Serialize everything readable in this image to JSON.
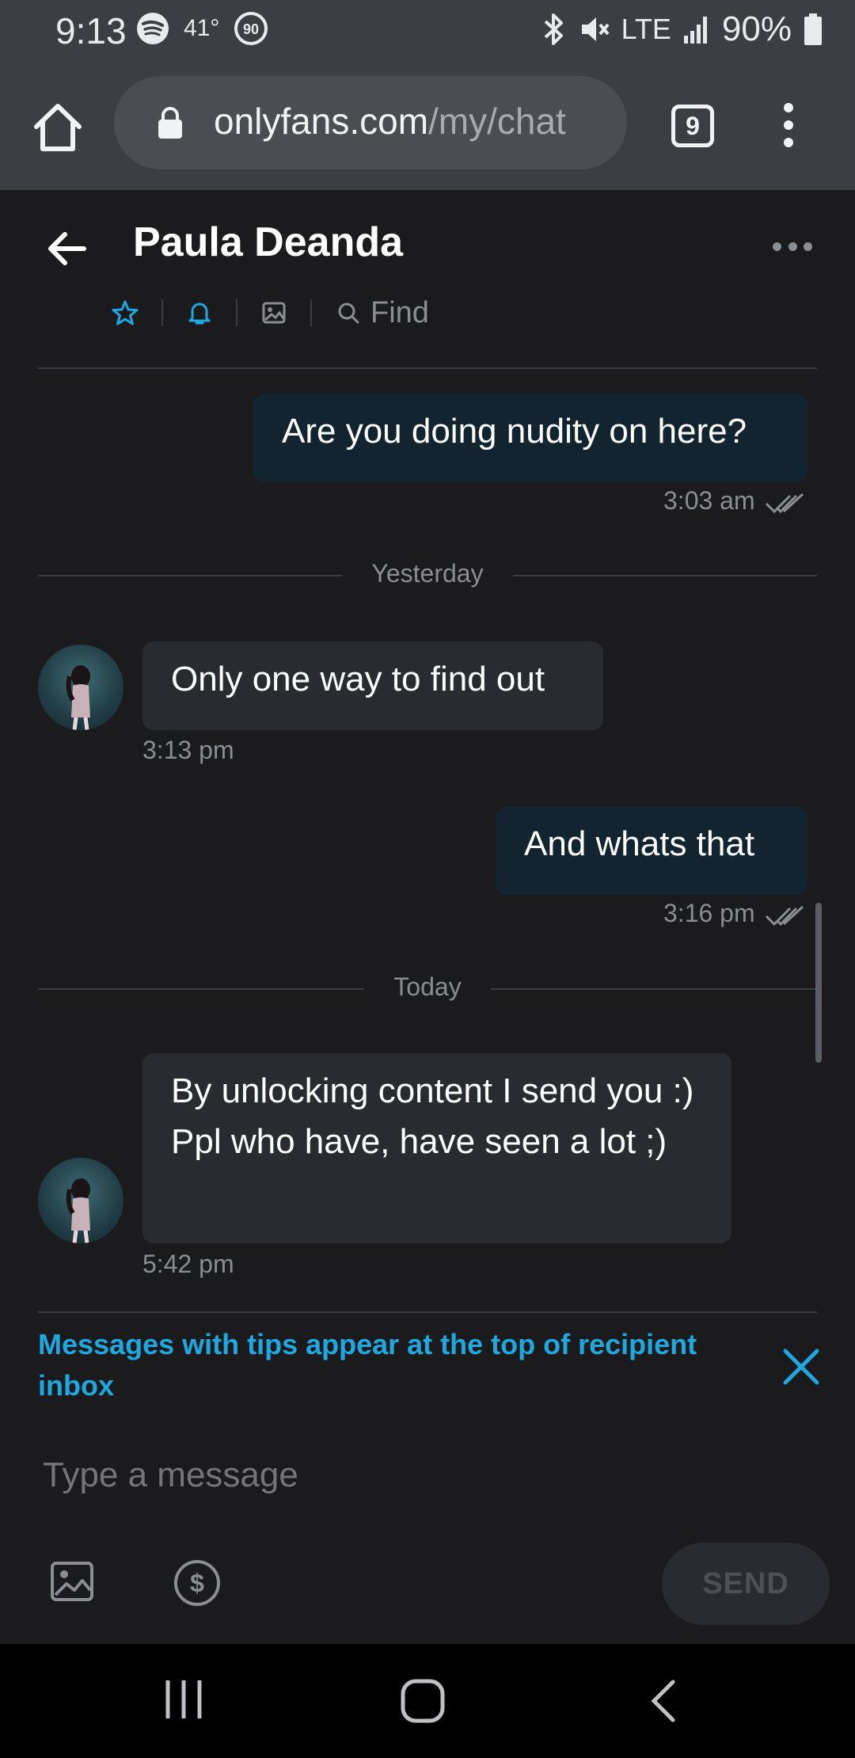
{
  "status_bar": {
    "time": "9:13",
    "temperature": "41°",
    "battery": "90%",
    "network": "LTE",
    "icons": [
      "spotify-icon",
      "temperature-90-icon",
      "bluetooth-icon",
      "mute-icon",
      "signal-icon",
      "battery-icon"
    ]
  },
  "browser": {
    "url_host": "onlyfans.com",
    "url_path": "/my/chat",
    "tab_count": "9"
  },
  "chat": {
    "title": "Paula Deanda",
    "find_label": "Find"
  },
  "messages": [
    {
      "direction": "out",
      "text": "Are you doing nudity on here?",
      "time": "3:03 am"
    },
    {
      "type": "day",
      "label": "Yesterday"
    },
    {
      "direction": "in",
      "text": "Only one way to find out",
      "time": "3:13 pm"
    },
    {
      "direction": "out",
      "text": "And whats that",
      "time": "3:16 pm"
    },
    {
      "type": "day",
      "label": "Today"
    },
    {
      "direction": "in",
      "text": "By unlocking content I send you :) Ppl who have, have seen a lot ;)",
      "time": "5:42 pm"
    }
  ],
  "tips_banner": {
    "text": "Messages with tips appear at the top of recipient inbox"
  },
  "composer": {
    "placeholder": "Type a message",
    "send_label": "SEND"
  },
  "colors": {
    "accent": "#1fa8e0",
    "background": "#1b1b1e",
    "outgoing_bubble": "#12242f",
    "incoming_bubble": "#2a2b30"
  }
}
